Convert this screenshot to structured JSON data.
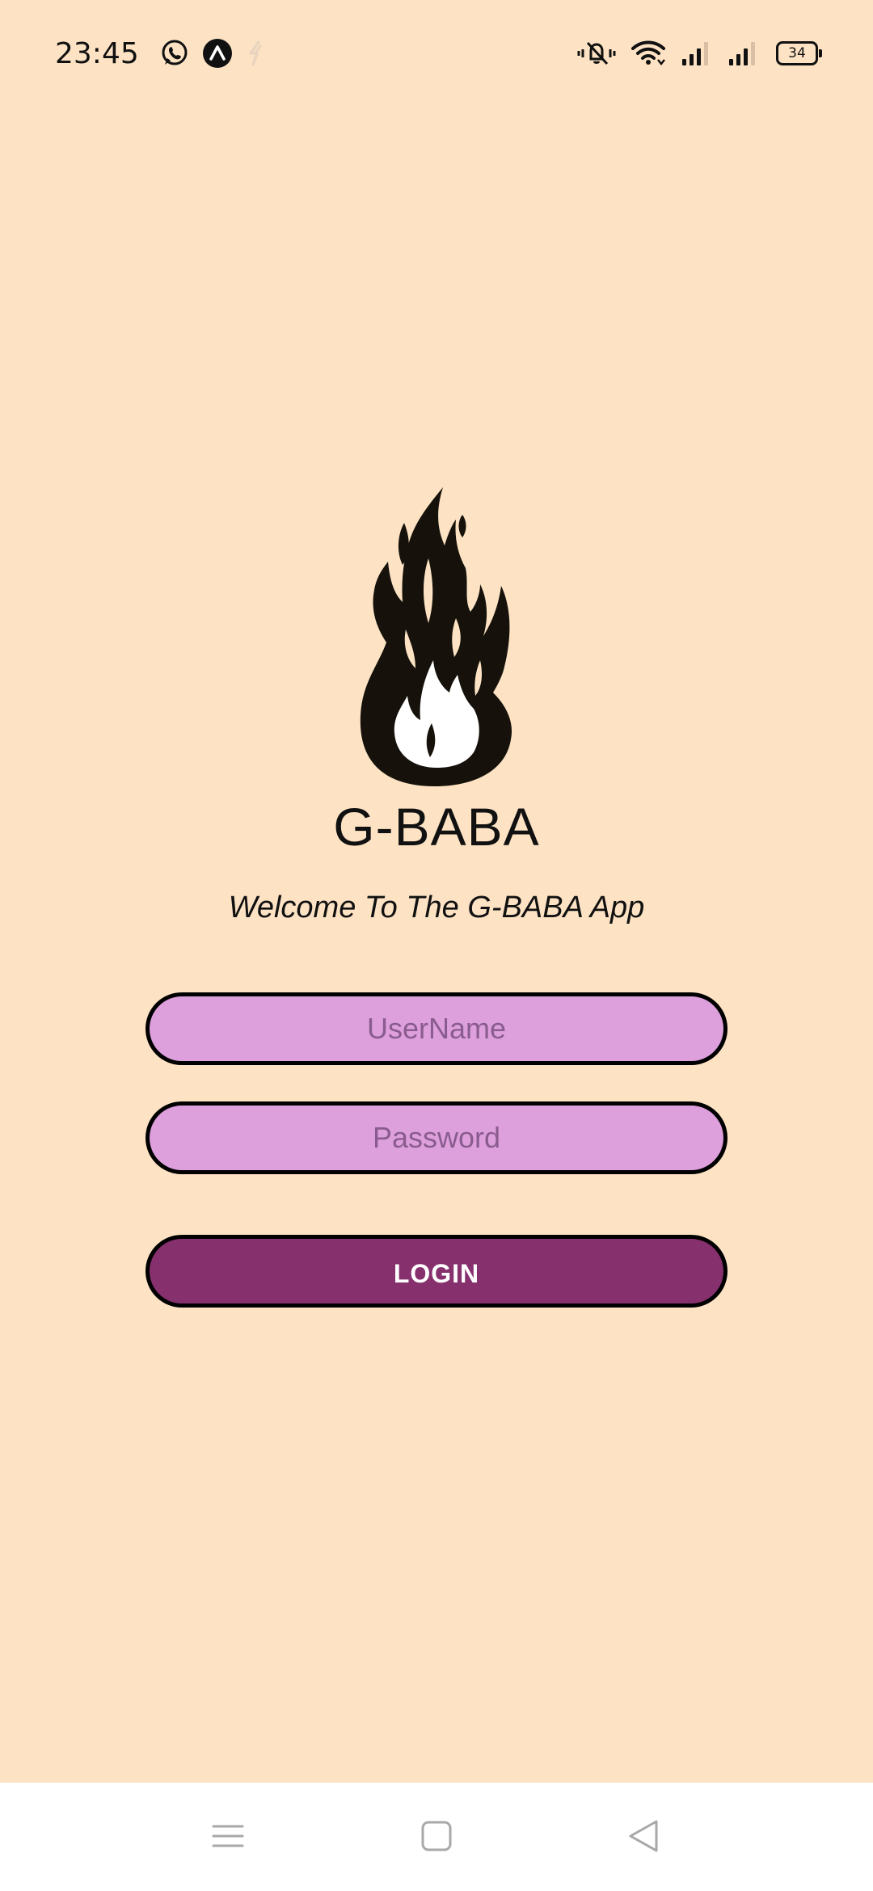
{
  "status_bar": {
    "time": "23:45",
    "battery_level": "34",
    "left_icons": [
      "whatsapp-icon",
      "app-a-icon",
      "sync-icon"
    ],
    "right_icons": [
      "vibrate-icon",
      "wifi-icon",
      "signal-icon",
      "signal-icon"
    ]
  },
  "app": {
    "title": "G-BABA",
    "subtitle": "Welcome To The G-BABA App",
    "logo_icon": "flame-icon"
  },
  "form": {
    "username_value": "",
    "username_placeholder": "UserName",
    "password_value": "",
    "password_placeholder": "Password",
    "login_label": "LOGIN"
  },
  "nav_bar": {
    "items": [
      "menu-icon",
      "home-icon",
      "back-icon"
    ]
  },
  "colors": {
    "background": "#FDE3C4",
    "field_fill": "#DDA0DD",
    "button_fill": "#87306E",
    "outline": "#000000",
    "nav_bar": "#FFFFFF"
  }
}
